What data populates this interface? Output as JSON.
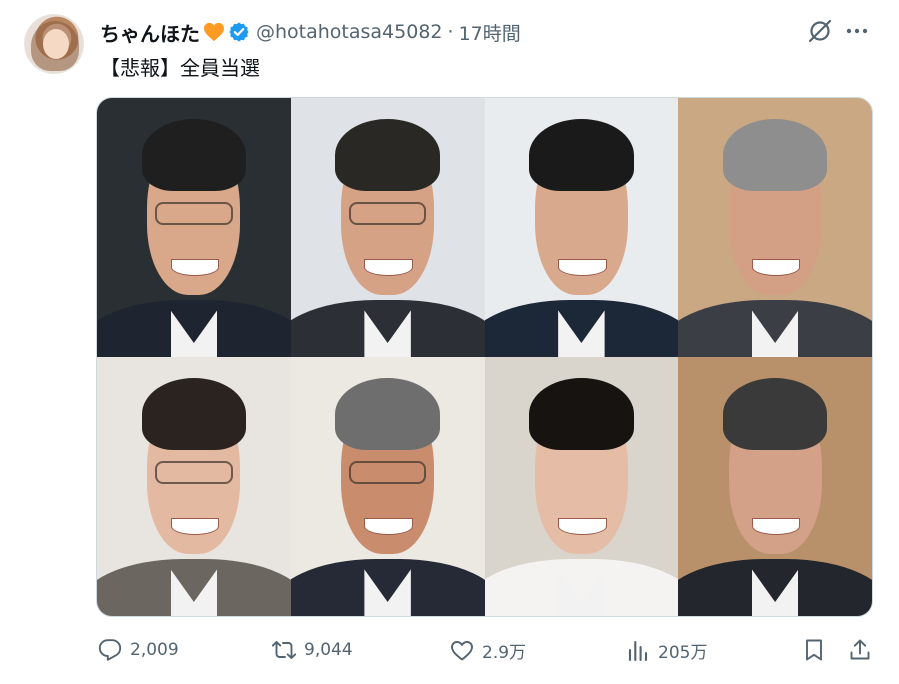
{
  "user": {
    "display_name": "ちゃんほた",
    "handle": "@hotahotasa45082",
    "separator": "·",
    "time": "17時間"
  },
  "tweet": {
    "text": "【悲報】全員当選"
  },
  "media": {
    "photos": [
      {
        "bg": "#2a2f33",
        "suit": "#1e2430",
        "skin": "#d9a78a",
        "hair": "#1f1f1f",
        "glasses": true
      },
      {
        "bg": "#dfe2e6",
        "suit": "#2d2f36",
        "skin": "#d6a285",
        "hair": "#2a2824",
        "glasses": true
      },
      {
        "bg": "#e9ecef",
        "suit": "#1c2738",
        "skin": "#d9a98e",
        "hair": "#1a1a1a",
        "glasses": false
      },
      {
        "bg": "#c9a883",
        "suit": "#3c3e45",
        "skin": "#d4a085",
        "hair": "#8e8e8e",
        "glasses": false
      },
      {
        "bg": "#e8e5e1",
        "suit": "#6b6760",
        "skin": "#e3b9a1",
        "hair": "#2a2320",
        "glasses": true
      },
      {
        "bg": "#ece8e2",
        "suit": "#252a36",
        "skin": "#c98d6e",
        "hair": "#6e6e6e",
        "glasses": true
      },
      {
        "bg": "#d9d4cc",
        "suit": "#f4f3f1",
        "skin": "#e5bda6",
        "hair": "#161311",
        "glasses": false
      },
      {
        "bg": "#b8916a",
        "suit": "#23262d",
        "skin": "#d3a088",
        "hair": "#3a3a3a",
        "glasses": false
      }
    ]
  },
  "actions": {
    "replies": "2,009",
    "reposts": "9,044",
    "likes": "2.9万",
    "views": "205万"
  },
  "icons": {
    "heart_emoji": "orange-heart-icon",
    "verified": "verified-badge-icon",
    "grok": "grok-icon",
    "more": "more-icon",
    "reply": "reply-icon",
    "repost": "repost-icon",
    "like": "like-icon",
    "views": "views-icon",
    "bookmark": "bookmark-icon",
    "share": "share-icon"
  },
  "colors": {
    "text": "#0f1419",
    "muted": "#536471",
    "verified": "#1d9bf0",
    "heart": "#ff9b21"
  }
}
